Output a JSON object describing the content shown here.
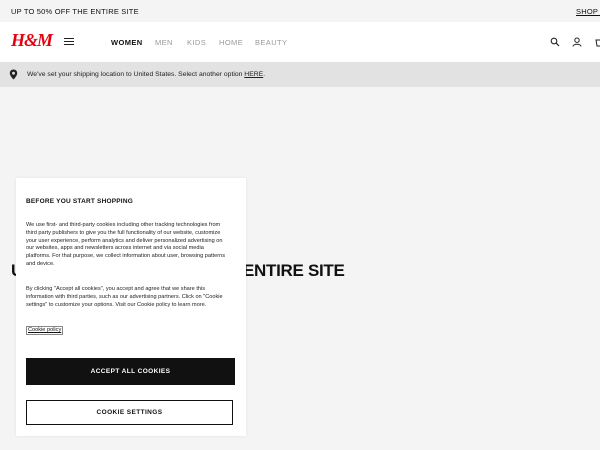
{
  "promo": {
    "text": "UP TO 50% OFF THE ENTIRE SITE",
    "link": "SHOP I"
  },
  "header": {
    "logo": "H&M",
    "nav": [
      "WOMEN",
      "MEN",
      "KIDS",
      "HOME",
      "BEAUTY"
    ],
    "active_nav": "WOMEN",
    "icons": [
      "search-icon",
      "account-icon",
      "cart-icon"
    ]
  },
  "shipping": {
    "message": "We've set your shipping location to United States. Select another option ",
    "link": "HERE",
    "end": "."
  },
  "hero": {
    "text_left": "U",
    "text_right": "ENTIRE SITE"
  },
  "cookie_modal": {
    "title": "BEFORE YOU START SHOPPING",
    "paragraph1": "We use first- and third-party cookies including other tracking technologies from third party publishers to give you the full functionality of our website, customize your user experience, perform analytics and deliver personalized advertising on our websites, apps and newsletters across internet and via social media platforms. For that purpose, we collect information about user, browsing patterns and device.",
    "paragraph2": "By clicking \"Accept all cookies\", you accept and agree that we share this information with third parties, such as our advertising partners. Click on \"Cookie settings\" to customize your options. Visit our Cookie policy to learn more.",
    "policy_link": "Cookie policy",
    "accept_label": "ACCEPT ALL COOKIES",
    "settings_label": "COOKIE SETTINGS"
  },
  "colors": {
    "brand_red": "#e50010",
    "accent_black": "#111111"
  }
}
